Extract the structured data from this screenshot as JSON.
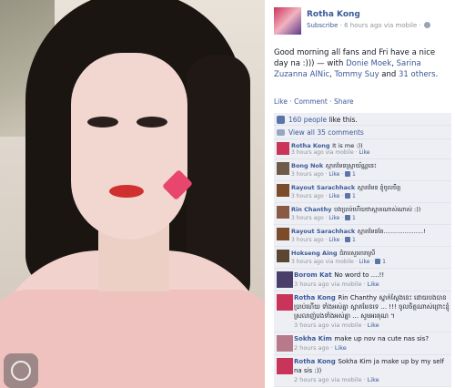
{
  "post": {
    "author": "Rotha Kong",
    "subscribe": "Subscribe",
    "time": "· 6 hours ago via mobile ·",
    "text_prefix": "Good morning all fans and Fri have a nice day na :))) — with ",
    "tag1": "Donie Moek",
    "sep1": ", ",
    "tag2": "Sarina Zuzanna AlNic",
    "sep2": ", ",
    "tag3": "Tommy Suy",
    "sep3": " and ",
    "tag4": "31 others",
    "end": ".",
    "actions": "Like · Comment · Share"
  },
  "ufi": {
    "likes_count": "160 people",
    "likes_suffix": " like this.",
    "view_all": "View all 35 comments"
  },
  "comments": [
    {
      "name": "Rotha Kong",
      "text": "It is me :))",
      "meta": "3 hours ago via mobile · ",
      "like": "Like",
      "count": "",
      "avatar_color": "#c9355a"
    },
    {
      "name": "Bong Nok",
      "text": "ស្អាតមែនស្រ្តាយ័ណ្ណនេះ",
      "meta": "3 hours ago · ",
      "like": "Like",
      "count": "1",
      "avatar_color": "#6f5a4a"
    },
    {
      "name": "Rayout Sarachhack",
      "text": "ស្អាតមែន ខ្ញុំចូលចិត្ត",
      "meta": "3 hours ago · ",
      "like": "Like",
      "count": "1",
      "avatar_color": "#7b4b2a"
    },
    {
      "name": "Rin Chanthy",
      "text": "បងប្រាប់ហើយថាស្អាតណាស់ណាស់ :))",
      "meta": "3 hours ago · ",
      "like": "Like",
      "count": "1",
      "avatar_color": "#8a5b44"
    },
    {
      "name": "Rayout Sarachhack",
      "text": "ស្អាតមែនតែ.....................!",
      "meta": "3 hours ago · ",
      "like": "Like",
      "count": "1",
      "avatar_color": "#7b4b2a"
    },
    {
      "name": "Hokseng Aing",
      "text": "ជំរាបសួរតារាស្រី",
      "meta": "3 hours ago via mobile · ",
      "like": "Like",
      "count": "1",
      "avatar_color": "#5a4632"
    },
    {
      "name": "Borom Kat",
      "text": "No word to ....!!",
      "meta": "3 hours ago via mobile · ",
      "like": "Like",
      "count": "",
      "avatar_color": "#4a3f6b"
    },
    {
      "name": "Rotha Kong",
      "text": "Rin Chanthy ស្នាក់ស្តែងនេះ ដោយបងបានប្រាប់ហើយ ទាំងអស់គ្នា ស្អាតមែនទេ ... !!! ចូលចិត្តណាស់ព្រោះខ្ញុំស្រលាញ់បងទាំងអស់គ្នា ... សូមអរគុណ ។",
      "meta": "3 hours ago via mobile · ",
      "like": "Like",
      "count": "",
      "avatar_color": "#c9355a"
    },
    {
      "name": "Sokha Kim",
      "text": "make up nov na cute nas sis?",
      "meta": "2 hours ago · ",
      "like": "Like",
      "count": "",
      "avatar_color": "#b77a8a"
    },
    {
      "name": "Rotha Kong",
      "text": "Sokha Kim ja make up by my self na sis :))",
      "meta": "2 hours ago via mobile · ",
      "like": "Like",
      "count": "",
      "avatar_color": "#c9355a"
    }
  ],
  "colors": {
    "link": "#3b5998",
    "ufi_bg": "#edeff4",
    "meta": "#90949c"
  }
}
